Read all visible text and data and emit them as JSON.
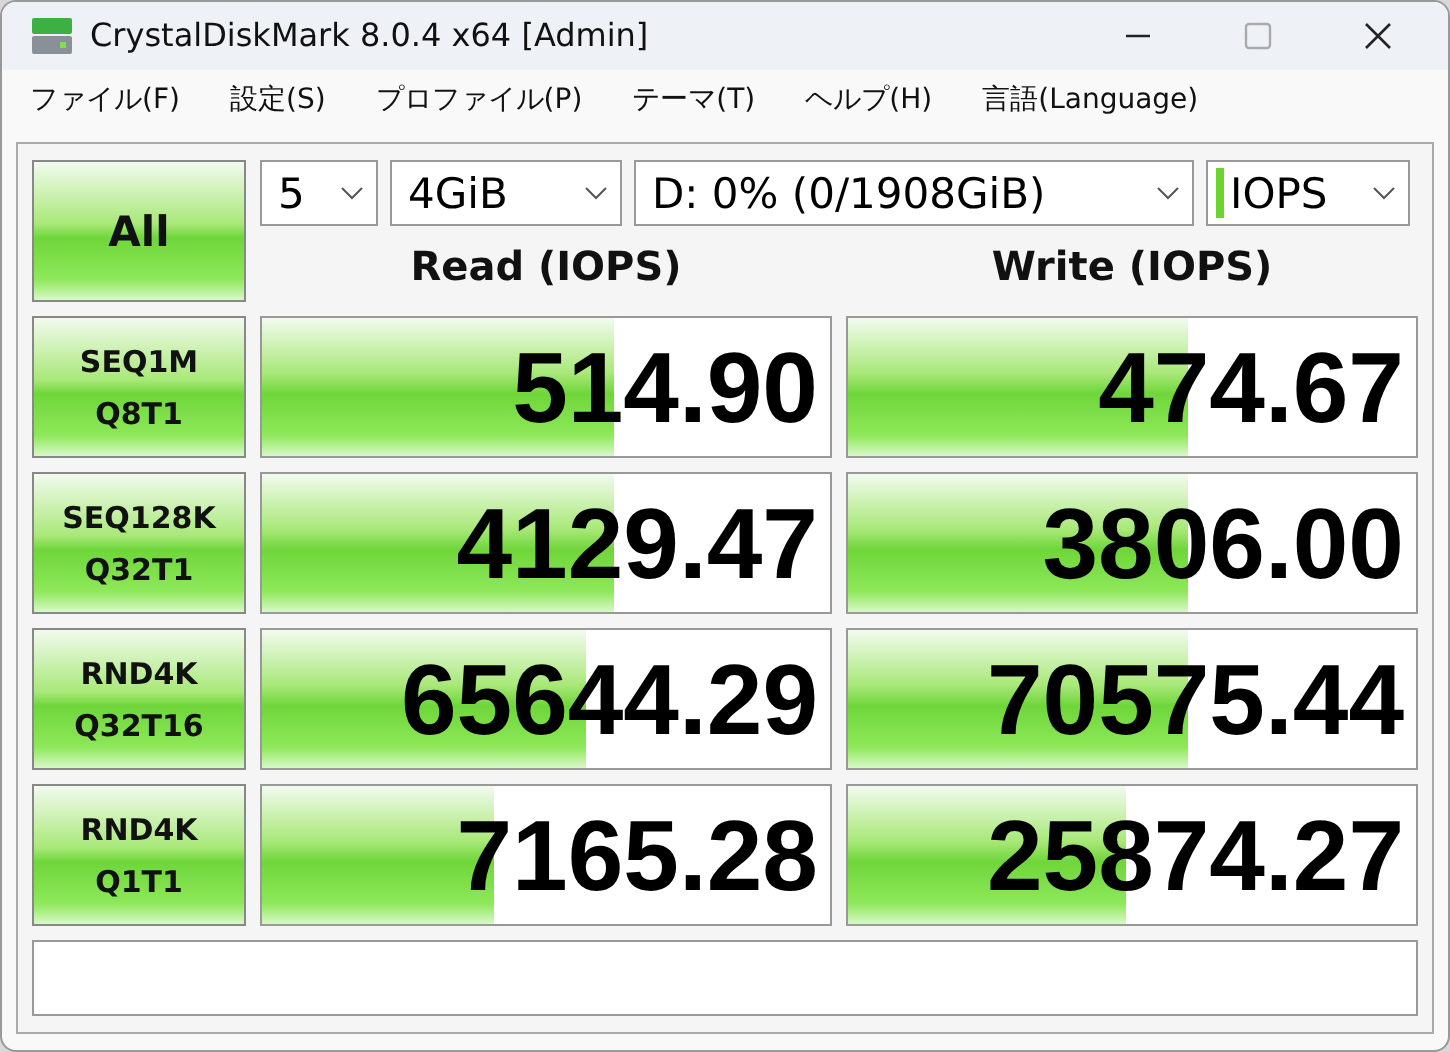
{
  "window": {
    "title": "CrystalDiskMark 8.0.4 x64 [Admin]"
  },
  "menu": [
    "ファイル(F)",
    "設定(S)",
    "プロファイル(P)",
    "テーマ(T)",
    "ヘルプ(H)",
    "言語(Language)"
  ],
  "all_button": "All",
  "selectors": [
    {
      "kind": "plain",
      "value": "5"
    },
    {
      "kind": "plain",
      "value": "4GiB"
    },
    {
      "kind": "plain",
      "value": "D: 0% (0/1908GiB)"
    },
    {
      "kind": "unit",
      "value": "IOPS"
    }
  ],
  "headers": [
    "Read (IOPS)",
    "Write (IOPS)"
  ],
  "rows": [
    {
      "test": [
        "SEQ1M",
        "Q8T1"
      ],
      "read": {
        "value": "514.90",
        "level": 0.62
      },
      "write": {
        "value": "474.67",
        "level": 0.6
      }
    },
    {
      "test": [
        "SEQ128K",
        "Q32T1"
      ],
      "read": {
        "value": "4129.47",
        "level": 0.62
      },
      "write": {
        "value": "3806.00",
        "level": 0.6
      }
    },
    {
      "test": [
        "RND4K",
        "Q32T16"
      ],
      "read": {
        "value": "65644.29",
        "level": 0.57
      },
      "write": {
        "value": "70575.44",
        "level": 0.6
      }
    },
    {
      "test": [
        "RND4K",
        "Q1T1"
      ],
      "read": {
        "value": "7165.28",
        "level": 0.41
      },
      "write": {
        "value": "25874.27",
        "level": 0.49
      }
    }
  ]
}
